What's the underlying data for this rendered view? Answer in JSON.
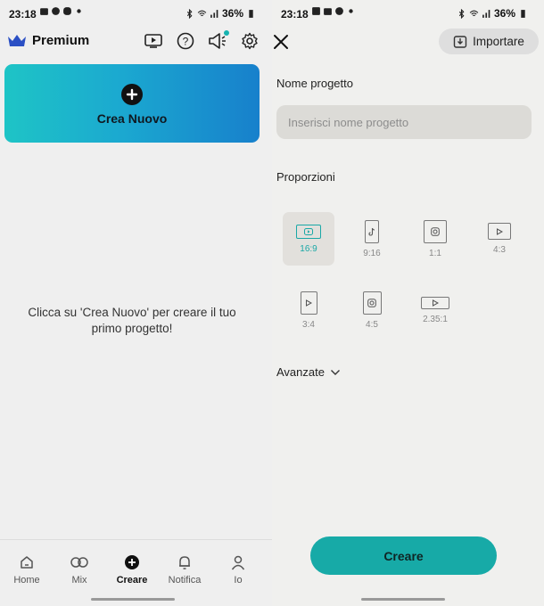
{
  "status_left": {
    "time": "23:18",
    "battery": "36%"
  },
  "status_right": {
    "time": "23:18",
    "battery": "36%"
  },
  "left": {
    "brand": "Premium",
    "create_card_label": "Crea Nuovo",
    "empty_message": "Clicca su 'Crea Nuovo' per creare il tuo primo progetto!",
    "nav": [
      {
        "label": "Home",
        "icon": "home-icon"
      },
      {
        "label": "Mix",
        "icon": "mix-icon"
      },
      {
        "label": "Creare",
        "icon": "create-icon"
      },
      {
        "label": "Notifica",
        "icon": "bell-icon"
      },
      {
        "label": "Io",
        "icon": "user-icon"
      }
    ],
    "active_nav": "Creare",
    "accent_color": "#15b3b0"
  },
  "right": {
    "import_label": "Importare",
    "name_label": "Nome progetto",
    "name_placeholder": "Inserisci nome progetto",
    "ratio_label": "Proporzioni",
    "ratios": [
      {
        "label": "16:9",
        "icon": "youtube-icon",
        "selected": true
      },
      {
        "label": "9:16",
        "icon": "tiktok-icon",
        "selected": false
      },
      {
        "label": "1:1",
        "icon": "instagram-icon",
        "selected": false
      },
      {
        "label": "4:3",
        "icon": "youtube-icon",
        "selected": false
      },
      {
        "label": "3:4",
        "icon": "youtube-icon",
        "selected": false
      },
      {
        "label": "4:5",
        "icon": "instagram-icon",
        "selected": false
      },
      {
        "label": "2.35:1",
        "icon": "youtube-icon",
        "selected": false
      }
    ],
    "advanced_label": "Avanzate",
    "create_button": "Creare",
    "button_color": "#17aaa7"
  }
}
